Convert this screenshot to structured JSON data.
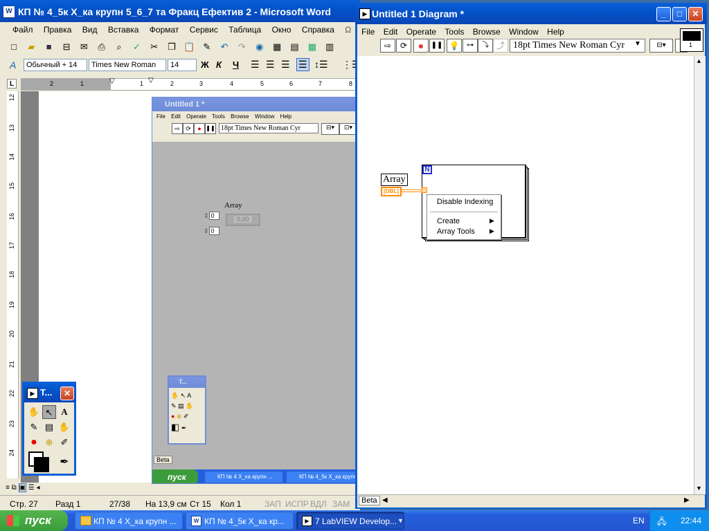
{
  "word": {
    "title": "КП № 4_5к Х_ка крупн 5_6_7 та Фракц Ефектив 2 - Microsoft Word",
    "menu": [
      "Файл",
      "Правка",
      "Вид",
      "Вставка",
      "Формат",
      "Сервис",
      "Таблица",
      "Окно",
      "Справка"
    ],
    "style_value": "Обычный + 14",
    "font_value": "Times New Roman",
    "size_value": "14",
    "bold": "Ж",
    "italic": "К",
    "underline": "Ч",
    "status": {
      "page": "Стр. 27",
      "section": "Разд 1",
      "pages": "27/38",
      "at": "На 13,9 см",
      "line": "Ст 15",
      "col": "Кол 1",
      "rec": "ЗАП",
      "trk": "ИСПР",
      "ext": "ВДЛ",
      "ovr": "ЗАМ"
    },
    "ruler_marks": [
      "2",
      "1",
      "1",
      "2",
      "3",
      "4",
      "5",
      "6",
      "7",
      "8"
    ],
    "vruler_marks": [
      "12",
      "13",
      "14",
      "15",
      "16",
      "17",
      "18",
      "19",
      "20",
      "21",
      "22",
      "23",
      "24"
    ]
  },
  "inner_front_panel": {
    "title": "Untitled 1 *",
    "menu": [
      "File",
      "Edit",
      "Operate",
      "Tools",
      "Browse",
      "Window",
      "Help"
    ],
    "font_value": "18pt Times New Roman Cyr",
    "array_label": "Array",
    "index_value_1": "0",
    "index_value_2": "0",
    "element_value": "0,00",
    "beta_label": "Beta",
    "tools_title": "T...",
    "taskbar_start": "пуск",
    "taskbar_items": [
      "КП № 4 Х_ка крупн ...",
      "КП № 4_5к Х_ка крупн ..."
    ]
  },
  "diagram": {
    "title": "Untitled 1 Diagram *",
    "menu": [
      "File",
      "Edit",
      "Operate",
      "Tools",
      "Browse",
      "Window",
      "Help"
    ],
    "font_value": "18pt Times New Roman Cyr",
    "array_label": "Array",
    "terminal_label": "DBL",
    "loop_label": "N",
    "beta_label": "Beta",
    "context_menu": {
      "items": [
        "Disable Indexing",
        "Create",
        "Array Tools"
      ]
    },
    "corner_icon_label": "1"
  },
  "tools_palette": {
    "title": "T..."
  },
  "taskbar": {
    "start_label": "пуск",
    "items": [
      "КП № 4 Х_ка крупн ...",
      "КП № 4_5к Х_ка кр...",
      "7 LabVIEW Develop..."
    ],
    "lang": "EN",
    "clock": "22:44"
  },
  "colors": {
    "xp_blue": "#0a5fd8",
    "lv_gray": "#b4b4b4",
    "dbl_orange": "#ff8c00",
    "taskbar": "#245edb",
    "start_green": "#3c9c3c"
  }
}
